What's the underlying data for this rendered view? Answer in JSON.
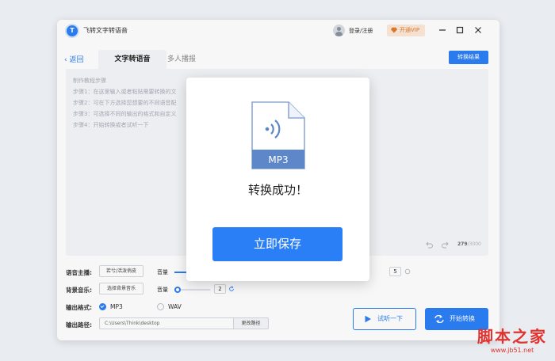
{
  "titlebar": {
    "app_title": "飞转文字转语音",
    "logo_text": "T",
    "login": "登录/注册",
    "vip": "开通VIP"
  },
  "nav": {
    "back": "返回",
    "tabs": [
      {
        "label": "文字转语音",
        "active": true
      },
      {
        "label": "多人播报",
        "active": false
      }
    ],
    "result_button": "转换结果"
  },
  "editor": {
    "hints": [
      "制作教程步骤",
      "步骤1：在这里输入或者粘贴需要转换的文",
      "步骤2：可在下方选择您想要的不同语音配",
      "步骤3：可选择不同的输出的格式和自定义",
      "步骤4：开始转换或者试听一下"
    ],
    "count": "279",
    "max": "/3000"
  },
  "settings": {
    "voice_label": "语音主播:",
    "voice_value": "若兮/活泼俏皮",
    "voice_volume_label": "音量",
    "voice_speed_value": "5",
    "bgm_label": "背景音乐:",
    "bgm_value": "选择背景音乐",
    "bgm_volume_label": "音量",
    "bgm_volume_value": "2",
    "bgm_volume_level": 0.05,
    "format_label": "输出格式:",
    "formats": [
      {
        "label": "MP3",
        "selected": true
      },
      {
        "label": "WAV",
        "selected": false
      }
    ],
    "path_label": "输出路径:",
    "path_value": "C:\\Users\\Think\\desktop",
    "path_button": "更改路径"
  },
  "actions": {
    "listen": "试听一下",
    "start": "开始转换"
  },
  "modal": {
    "file_type": "MP3",
    "message": "转换成功！",
    "save_button": "立即保存"
  },
  "watermark": {
    "main": "脚本之家",
    "url": "www.jb51.net"
  },
  "colors": {
    "accent": "#2b7ff6",
    "vip_bg": "#fde9d8",
    "vip_text": "#e27b2c",
    "watermark": "#e3312d"
  }
}
